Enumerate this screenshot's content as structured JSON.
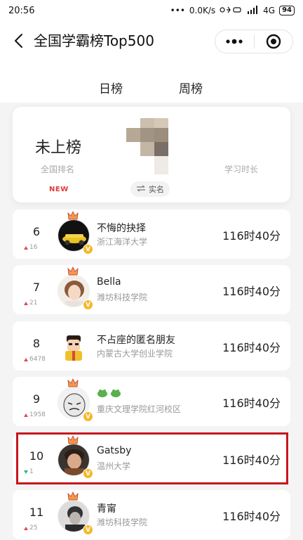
{
  "status_bar": {
    "time": "20:56",
    "dots": "•••",
    "speed": "0.0K/s",
    "network": "4G",
    "battery": "94"
  },
  "nav": {
    "title": "全国学霸榜Top500"
  },
  "tabs": [
    {
      "label": "日榜",
      "active": false
    },
    {
      "label": "周榜",
      "active": true
    }
  ],
  "me": {
    "status": "未上榜",
    "rank_label": "全国排名",
    "badge": "NEW",
    "real_name_label": "实名",
    "time_label": "学习时长"
  },
  "rows": [
    {
      "rank": "6",
      "delta": "16",
      "trend": "up",
      "name": "不悔的抉择",
      "school": "浙江海洋大学",
      "time": "116时40分"
    },
    {
      "rank": "7",
      "delta": "21",
      "trend": "up",
      "name": "Bella",
      "school": "潍坊科技学院",
      "time": "116时40分"
    },
    {
      "rank": "8",
      "delta": "6478",
      "trend": "up",
      "name": "不占座的匿名朋友",
      "school": "内蒙古大学创业学院",
      "time": "116时40分"
    },
    {
      "rank": "9",
      "delta": "1958",
      "trend": "up",
      "name": "",
      "school": "重庆文理学院红河校区",
      "time": "116时40分"
    },
    {
      "rank": "10",
      "delta": "1",
      "trend": "down",
      "name": "Gatsby",
      "school": "温州大学",
      "time": "116时40分"
    },
    {
      "rank": "11",
      "delta": "25",
      "trend": "up",
      "name": "青甯",
      "school": "潍坊科技学院",
      "time": "116时40分"
    }
  ],
  "colors": {
    "accent_underline": "#f6c545",
    "highlight_border": "#c8151d",
    "up": "#e24b4b",
    "down": "#2fb38a",
    "vip_badge": "#f4b929"
  },
  "icons": {
    "back": "chevron-left-icon",
    "menu": "more-dots-icon",
    "close": "target-circle-icon",
    "crown": "crown-icon",
    "vip": "v-badge-icon",
    "swap": "swap-arrows-icon"
  }
}
